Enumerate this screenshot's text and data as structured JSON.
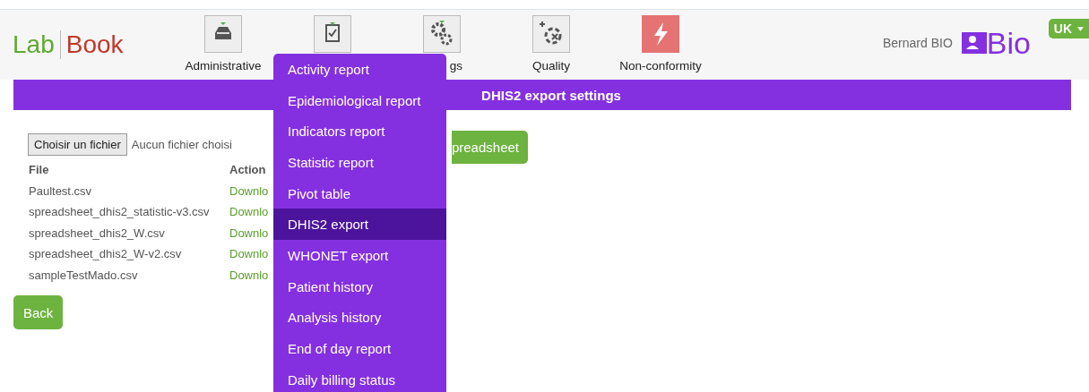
{
  "logo": {
    "part_1": "Lab",
    "part_2": "Book"
  },
  "nav": [
    {
      "kind": "inbox",
      "label": "Administrative"
    },
    {
      "kind": "clipboard"
    },
    {
      "kind": "gears",
      "label": "gs"
    },
    {
      "kind": "quality",
      "label": "Quality"
    },
    {
      "kind": "alert",
      "label": "Non-conformity"
    }
  ],
  "user": {
    "name": "Bernard BIO",
    "brand": "Bio"
  },
  "language": {
    "label": "UK"
  },
  "page_title": "DHIS2 export settings",
  "file_input": {
    "button": "Choisir un fichier",
    "status": "Aucun fichier choisi"
  },
  "upload_button": "preadsheet",
  "table": {
    "columns": [
      "File",
      "Action"
    ],
    "rows": [
      {
        "file": "Paultest.csv",
        "action": "Downlo"
      },
      {
        "file": "spreadsheet_dhis2_statistic-v3.csv",
        "action": "Downlo"
      },
      {
        "file": "spreadsheet_dhis2_W.csv",
        "action": "Downlo"
      },
      {
        "file": "spreadsheet_dhis2_W-v2.csv",
        "action": "Downlo"
      },
      {
        "file": "sampleTestMado.csv",
        "action": "Downlo"
      }
    ]
  },
  "back_button": "Back",
  "dropdown": [
    {
      "label": "Activity report",
      "selected": false
    },
    {
      "label": "Epidemiological report",
      "selected": false
    },
    {
      "label": "Indicators report",
      "selected": false
    },
    {
      "label": "Statistic report",
      "selected": false
    },
    {
      "label": "Pivot table",
      "selected": false
    },
    {
      "label": "DHIS2 export",
      "selected": true
    },
    {
      "label": "WHONET export",
      "selected": false
    },
    {
      "label": "Patient history",
      "selected": false
    },
    {
      "label": "Analysis history",
      "selected": false
    },
    {
      "label": "End of day report",
      "selected": false
    },
    {
      "label": "Daily billing status",
      "selected": false
    }
  ]
}
